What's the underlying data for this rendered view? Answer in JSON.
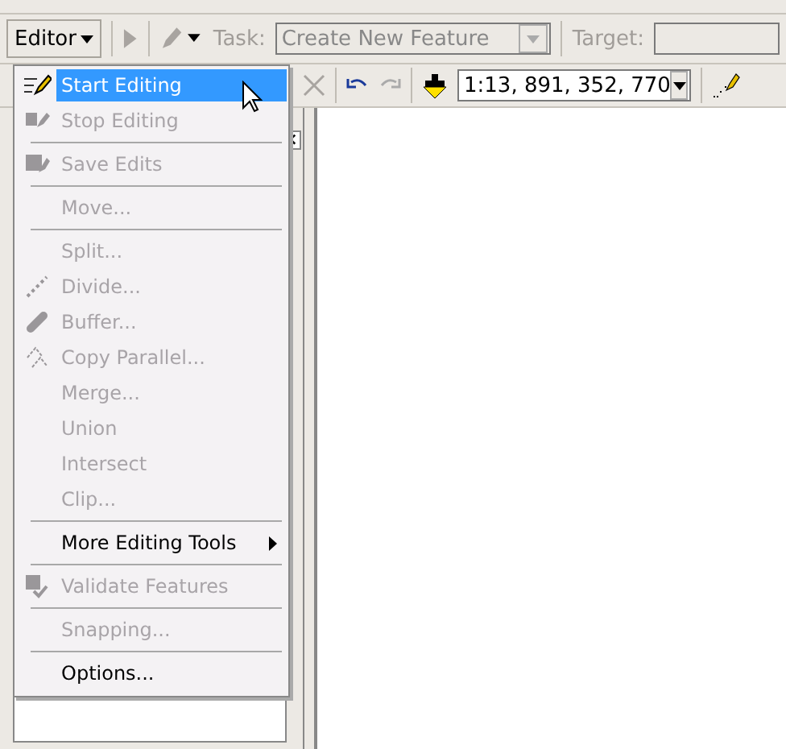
{
  "toolbar": {
    "editor_button": "Editor",
    "task_label": "Task:",
    "task_value": "Create New Feature",
    "target_label": "Target:"
  },
  "toolbar2": {
    "scale": "1:13, 891, 352, 770"
  },
  "editor_menu": [
    {
      "kind": "item",
      "label": "Start Editing",
      "disabled": false,
      "selected": true
    },
    {
      "kind": "item",
      "label": "Stop Editing",
      "disabled": true,
      "selected": false
    },
    {
      "kind": "separator"
    },
    {
      "kind": "item",
      "label": "Save Edits",
      "disabled": true,
      "selected": false
    },
    {
      "kind": "separator"
    },
    {
      "kind": "item",
      "label": "Move...",
      "disabled": true,
      "selected": false
    },
    {
      "kind": "separator"
    },
    {
      "kind": "item",
      "label": "Split...",
      "disabled": true,
      "selected": false
    },
    {
      "kind": "item",
      "label": "Divide...",
      "disabled": true,
      "selected": false
    },
    {
      "kind": "item",
      "label": "Buffer...",
      "disabled": true,
      "selected": false
    },
    {
      "kind": "item",
      "label": "Copy Parallel...",
      "disabled": true,
      "selected": false
    },
    {
      "kind": "item",
      "label": "Merge...",
      "disabled": true,
      "selected": false
    },
    {
      "kind": "item",
      "label": "Union",
      "disabled": true,
      "selected": false
    },
    {
      "kind": "item",
      "label": "Intersect",
      "disabled": true,
      "selected": false
    },
    {
      "kind": "item",
      "label": "Clip...",
      "disabled": true,
      "selected": false
    },
    {
      "kind": "separator"
    },
    {
      "kind": "submenu",
      "label": "More Editing Tools",
      "disabled": false,
      "selected": false
    },
    {
      "kind": "separator"
    },
    {
      "kind": "item",
      "label": "Validate Features",
      "disabled": true,
      "selected": false
    },
    {
      "kind": "separator"
    },
    {
      "kind": "item",
      "label": "Snapping...",
      "disabled": true,
      "selected": false
    },
    {
      "kind": "separator"
    },
    {
      "kind": "item",
      "label": "Options...",
      "disabled": false,
      "selected": false
    }
  ]
}
